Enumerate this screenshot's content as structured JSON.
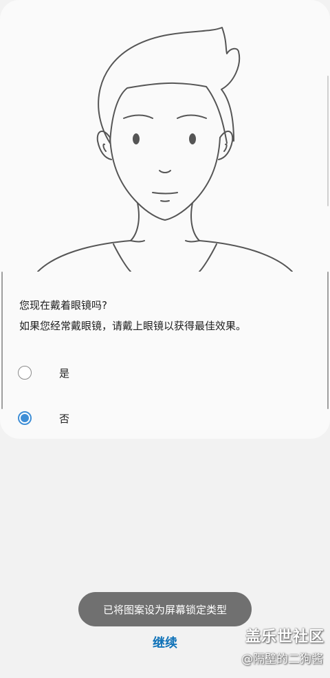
{
  "question": "您现在戴着眼镜吗?",
  "hint": "如果您经常戴眼镜，请戴上眼镜以获得最佳效果。",
  "options": [
    {
      "label": "是",
      "selected": false
    },
    {
      "label": "否",
      "selected": true
    }
  ],
  "toast": "已将图案设为屏幕锁定类型",
  "continue_label": "继续",
  "watermark": {
    "title": "盖乐世社区",
    "author": "@隔壁的二狗酱"
  },
  "colors": {
    "accent": "#3e8ed6",
    "continue": "#0f72b8",
    "toast_bg": "#707070"
  }
}
